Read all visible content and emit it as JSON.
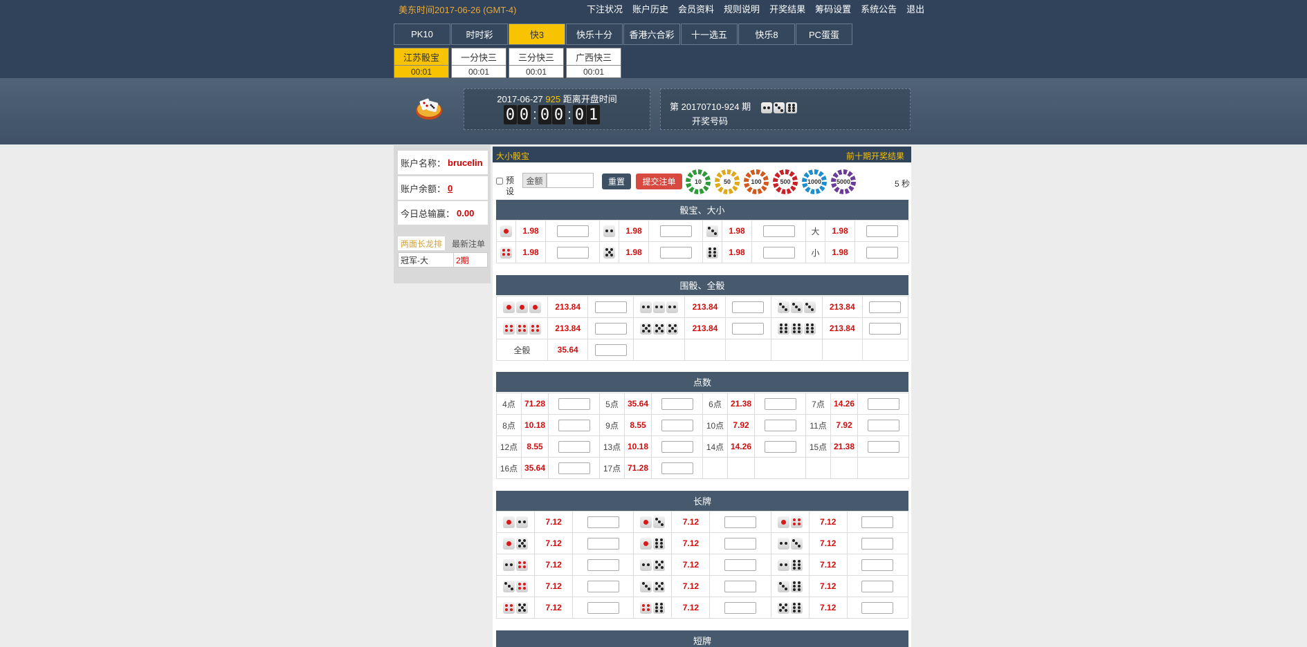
{
  "header": {
    "timezone": "美东时间2017-06-26 (GMT-4)",
    "links": [
      "下注状况",
      "账户历史",
      "会员资料",
      "规则说明",
      "开奖结果",
      "筹码设置",
      "系统公告",
      "退出"
    ],
    "tabs": [
      {
        "label": "PK10",
        "active": false
      },
      {
        "label": "时时彩",
        "active": false
      },
      {
        "label": "快3",
        "active": true
      },
      {
        "label": "快乐十分",
        "active": false
      },
      {
        "label": "香港六合彩",
        "active": false
      },
      {
        "label": "十一选五",
        "active": false
      },
      {
        "label": "快乐8",
        "active": false
      },
      {
        "label": "PC蛋蛋",
        "active": false
      }
    ],
    "subtabs": [
      {
        "name": "江苏骰宝",
        "time": "00:01",
        "active": true
      },
      {
        "name": "一分快三",
        "time": "00:01",
        "active": false
      },
      {
        "name": "三分快三",
        "time": "00:01",
        "active": false
      },
      {
        "name": "广西快三",
        "time": "00:01",
        "active": false
      }
    ]
  },
  "countdown": {
    "date": "2017-06-27",
    "period": "925",
    "label": "距离开盘时间",
    "digits": [
      "0",
      "0",
      "0",
      "0",
      "0",
      "1"
    ]
  },
  "issue": {
    "label": "第 20170710-924 期",
    "result_label": "开奖号码",
    "result_dice": [
      2,
      3,
      6
    ]
  },
  "account": {
    "name_label": "账户名称：",
    "name": "brucelin",
    "balance_label": "账户余额：",
    "balance": "0",
    "profit_label": "今日总输赢：",
    "profit": "0.00"
  },
  "sidetabs": {
    "tab1": "两面长龙排",
    "tab2": "最新注单"
  },
  "longdragon": [
    {
      "item": "冠军-大",
      "count": "2期"
    }
  ],
  "main": {
    "title": "大小骰宝",
    "recent_link": "前十期开奖结果",
    "preset_label": "预设",
    "amount_label": "金额",
    "reset_button": "重置",
    "submit_button": "提交注单",
    "timer": "5 秒",
    "chips": [
      {
        "value": "10",
        "color": "#2e9a3a"
      },
      {
        "value": "50",
        "color": "#e0a81c"
      },
      {
        "value": "100",
        "color": "#d25a1e"
      },
      {
        "value": "500",
        "color": "#c8222a"
      },
      {
        "value": "1000",
        "color": "#1d8fcc"
      },
      {
        "value": "5000",
        "color": "#6a3d9a"
      }
    ]
  },
  "sections": {
    "dice_size": "骰宝、大小",
    "triples": "围骰、全骰",
    "points": "点数",
    "long": "长牌",
    "short": "短牌"
  },
  "dice_size": {
    "rows": [
      [
        {
          "dice": [
            1
          ],
          "odds": "1.98"
        },
        {
          "dice": [
            2
          ],
          "odds": "1.98"
        },
        {
          "dice": [
            3
          ],
          "odds": "1.98"
        },
        {
          "label": "大",
          "odds": "1.98"
        }
      ],
      [
        {
          "dice": [
            4
          ],
          "odds": "1.98"
        },
        {
          "dice": [
            5
          ],
          "odds": "1.98"
        },
        {
          "dice": [
            6
          ],
          "odds": "1.98"
        },
        {
          "label": "小",
          "odds": "1.98"
        }
      ]
    ]
  },
  "triples": {
    "rows": [
      [
        {
          "dice": [
            1,
            1,
            1
          ],
          "odds": "213.84"
        },
        {
          "dice": [
            2,
            2,
            2
          ],
          "odds": "213.84"
        },
        {
          "dice": [
            3,
            3,
            3
          ],
          "odds": "213.84"
        }
      ],
      [
        {
          "dice": [
            4,
            4,
            4
          ],
          "odds": "213.84"
        },
        {
          "dice": [
            5,
            5,
            5
          ],
          "odds": "213.84"
        },
        {
          "dice": [
            6,
            6,
            6
          ],
          "odds": "213.84"
        }
      ]
    ],
    "any": {
      "label": "全骰",
      "odds": "35.64"
    }
  },
  "points": {
    "rows": [
      [
        {
          "label": "4点",
          "odds": "71.28"
        },
        {
          "label": "5点",
          "odds": "35.64"
        },
        {
          "label": "6点",
          "odds": "21.38"
        },
        {
          "label": "7点",
          "odds": "14.26"
        }
      ],
      [
        {
          "label": "8点",
          "odds": "10.18"
        },
        {
          "label": "9点",
          "odds": "8.55"
        },
        {
          "label": "10点",
          "odds": "7.92"
        },
        {
          "label": "11点",
          "odds": "7.92"
        }
      ],
      [
        {
          "label": "12点",
          "odds": "8.55"
        },
        {
          "label": "13点",
          "odds": "10.18"
        },
        {
          "label": "14点",
          "odds": "14.26"
        },
        {
          "label": "15点",
          "odds": "21.38"
        }
      ],
      [
        {
          "label": "16点",
          "odds": "35.64"
        },
        {
          "label": "17点",
          "odds": "71.28"
        }
      ]
    ]
  },
  "long": {
    "rows": [
      [
        {
          "dice": [
            1,
            2
          ],
          "odds": "7.12"
        },
        {
          "dice": [
            1,
            3
          ],
          "odds": "7.12"
        },
        {
          "dice": [
            1,
            4
          ],
          "odds": "7.12"
        }
      ],
      [
        {
          "dice": [
            1,
            5
          ],
          "odds": "7.12"
        },
        {
          "dice": [
            1,
            6
          ],
          "odds": "7.12"
        },
        {
          "dice": [
            2,
            3
          ],
          "odds": "7.12"
        }
      ],
      [
        {
          "dice": [
            2,
            4
          ],
          "odds": "7.12"
        },
        {
          "dice": [
            2,
            5
          ],
          "odds": "7.12"
        },
        {
          "dice": [
            2,
            6
          ],
          "odds": "7.12"
        }
      ],
      [
        {
          "dice": [
            3,
            4
          ],
          "odds": "7.12"
        },
        {
          "dice": [
            3,
            5
          ],
          "odds": "7.12"
        },
        {
          "dice": [
            3,
            6
          ],
          "odds": "7.12"
        }
      ],
      [
        {
          "dice": [
            4,
            5
          ],
          "odds": "7.12"
        },
        {
          "dice": [
            4,
            6
          ],
          "odds": "7.12"
        },
        {
          "dice": [
            5,
            6
          ],
          "odds": "7.12"
        }
      ]
    ]
  }
}
